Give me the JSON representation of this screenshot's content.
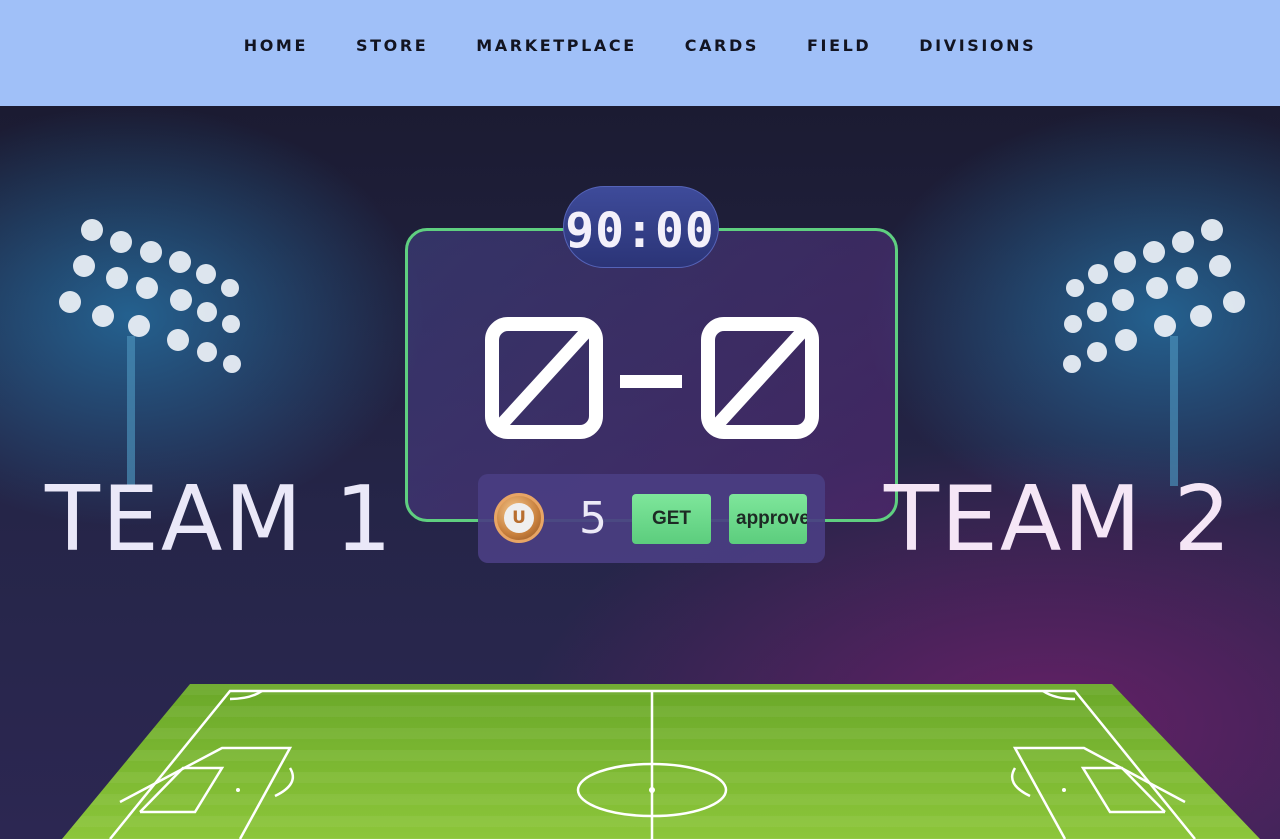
{
  "nav": {
    "items": [
      {
        "label": "HOME"
      },
      {
        "label": "STORE"
      },
      {
        "label": "MARKETPLACE"
      },
      {
        "label": "CARDS"
      },
      {
        "label": "FIELD"
      },
      {
        "label": "DIVISIONS"
      }
    ]
  },
  "match": {
    "timer": "90:00",
    "home_score": "0",
    "away_score": "0",
    "score_separator": "-",
    "team_1": "TEAM 1",
    "team_2": "TEAM 2"
  },
  "wallet": {
    "coin_icon": "coin-icon",
    "coin_letter": "U",
    "token_count": "5",
    "get_label": "GET",
    "approve_label": "approve"
  },
  "colors": {
    "nav_bg": "#a0c0f8",
    "scoreboard_border": "#5fcf80",
    "button_green": "#6fdc8c",
    "pitch_green": "#7dbb2f"
  }
}
